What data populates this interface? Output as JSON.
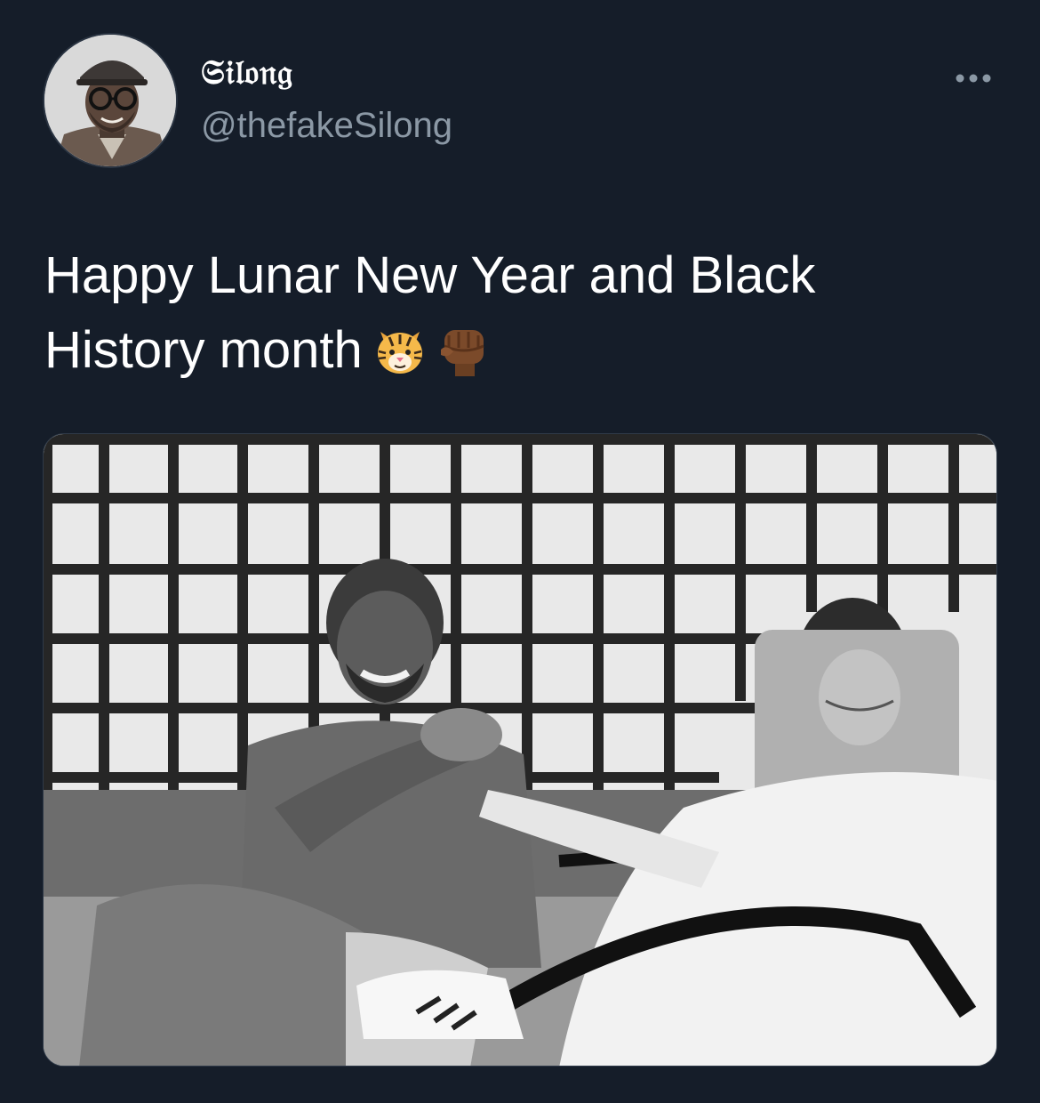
{
  "author": {
    "display_name": "𝔖𝔦𝔩𝔬𝔫𝔤",
    "handle": "@thefakeSilong",
    "avatar_icon": "profile-photo"
  },
  "more_menu": {
    "icon": "more-dots-icon"
  },
  "tweet": {
    "text_line_1": "Happy Lunar New Year and Black",
    "text_line_2": "History month",
    "emojis": [
      "tiger-face-emoji",
      "raised-fist-emoji"
    ]
  },
  "media": {
    "type": "photo"
  },
  "colors": {
    "background": "#151d29",
    "text": "#ffffff",
    "secondary_text": "#8b98a5"
  }
}
